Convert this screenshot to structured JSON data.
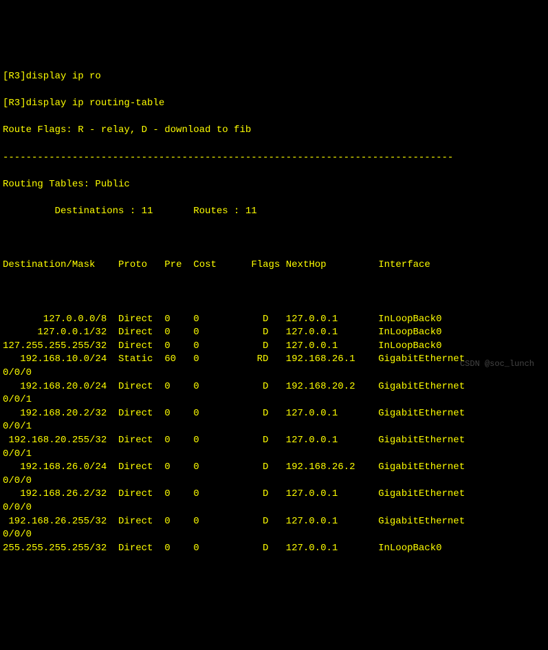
{
  "commands": [
    "[R3]display ip ro",
    "[R3]display ip routing-table"
  ],
  "route_flags_label": "Route Flags: R - relay, D - download to fib",
  "separator": "------------------------------------------------------------------------------",
  "tables_label": "Routing Tables: Public",
  "destinations_label": "         Destinations : 11       Routes : 11",
  "headers": {
    "dest": "Destination/Mask",
    "proto": "Proto",
    "pre": "Pre",
    "cost": "Cost",
    "flags": "Flags",
    "nexthop": "NextHop",
    "interface": "Interface"
  },
  "chart_data": {
    "type": "table",
    "columns": [
      "Destination/Mask",
      "Proto",
      "Pre",
      "Cost",
      "Flags",
      "NextHop",
      "Interface"
    ],
    "rows": [
      {
        "dest": "127.0.0.0/8",
        "proto": "Direct",
        "pre": "0",
        "cost": "0",
        "flags": "D",
        "nexthop": "127.0.0.1",
        "interface": "InLoopBack0",
        "wrap": ""
      },
      {
        "dest": "127.0.0.1/32",
        "proto": "Direct",
        "pre": "0",
        "cost": "0",
        "flags": "D",
        "nexthop": "127.0.0.1",
        "interface": "InLoopBack0",
        "wrap": ""
      },
      {
        "dest": "127.255.255.255/32",
        "proto": "Direct",
        "pre": "0",
        "cost": "0",
        "flags": "D",
        "nexthop": "127.0.0.1",
        "interface": "InLoopBack0",
        "wrap": ""
      },
      {
        "dest": "192.168.10.0/24",
        "proto": "Static",
        "pre": "60",
        "cost": "0",
        "flags": "RD",
        "nexthop": "192.168.26.1",
        "interface": "GigabitEthernet",
        "wrap": "0/0/0"
      },
      {
        "dest": "192.168.20.0/24",
        "proto": "Direct",
        "pre": "0",
        "cost": "0",
        "flags": "D",
        "nexthop": "192.168.20.2",
        "interface": "GigabitEthernet",
        "wrap": "0/0/1"
      },
      {
        "dest": "192.168.20.2/32",
        "proto": "Direct",
        "pre": "0",
        "cost": "0",
        "flags": "D",
        "nexthop": "127.0.0.1",
        "interface": "GigabitEthernet",
        "wrap": "0/0/1"
      },
      {
        "dest": "192.168.20.255/32",
        "proto": "Direct",
        "pre": "0",
        "cost": "0",
        "flags": "D",
        "nexthop": "127.0.0.1",
        "interface": "GigabitEthernet",
        "wrap": "0/0/1"
      },
      {
        "dest": "192.168.26.0/24",
        "proto": "Direct",
        "pre": "0",
        "cost": "0",
        "flags": "D",
        "nexthop": "192.168.26.2",
        "interface": "GigabitEthernet",
        "wrap": "0/0/0"
      },
      {
        "dest": "192.168.26.2/32",
        "proto": "Direct",
        "pre": "0",
        "cost": "0",
        "flags": "D",
        "nexthop": "127.0.0.1",
        "interface": "GigabitEthernet",
        "wrap": "0/0/0"
      },
      {
        "dest": "192.168.26.255/32",
        "proto": "Direct",
        "pre": "0",
        "cost": "0",
        "flags": "D",
        "nexthop": "127.0.0.1",
        "interface": "GigabitEthernet",
        "wrap": "0/0/0"
      },
      {
        "dest": "255.255.255.255/32",
        "proto": "Direct",
        "pre": "0",
        "cost": "0",
        "flags": "D",
        "nexthop": "127.0.0.1",
        "interface": "InLoopBack0",
        "wrap": ""
      }
    ]
  },
  "watermark": "CSDN @soc_lunch"
}
